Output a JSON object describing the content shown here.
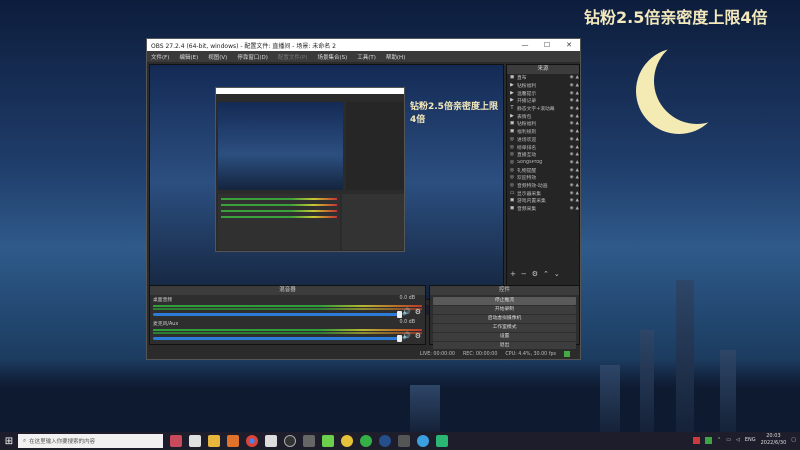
{
  "desktop": {
    "banner": "钻粉2.5倍亲密度上限4倍"
  },
  "window": {
    "title": "OBS 27.2.4 (64-bit, windows) - 配置文件: 直播间 - 场景: 未命名 2",
    "menu": [
      "文件(F)",
      "编辑(E)",
      "视图(V)",
      "停靠窗口(D)",
      "配置文件(P)",
      "场景集合(S)",
      "工具(T)",
      "帮助(H)"
    ]
  },
  "preview": {
    "watermark": "钻粉2.5倍亲密度上限4倍",
    "mini_search": "在这里输入你要搜索的内容"
  },
  "sources": {
    "title": "来源",
    "items": [
      {
        "label": "直布",
        "icon": "image"
      },
      {
        "label": "钻粉福利",
        "icon": "play"
      },
      {
        "label": "温馨提示",
        "icon": "play"
      },
      {
        "label": "开播记录",
        "icon": "play"
      },
      {
        "label": "静态文字+滚动幕",
        "icon": "text"
      },
      {
        "label": "表情包",
        "icon": "play"
      },
      {
        "label": "钻粉福利",
        "icon": "image"
      },
      {
        "label": "福利规则",
        "icon": "image"
      },
      {
        "label": "进场欢迎",
        "icon": "globe"
      },
      {
        "label": "榜单排名",
        "icon": "globe"
      },
      {
        "label": "直播互动",
        "icon": "globe"
      },
      {
        "label": "SongsProg",
        "icon": "globe"
      },
      {
        "label": "礼物提醒",
        "icon": "globe"
      },
      {
        "label": "欢迎特效",
        "icon": "globe"
      },
      {
        "label": "音频特效-动画",
        "icon": "globe"
      },
      {
        "label": "显示器采集",
        "icon": "monitor"
      },
      {
        "label": "游戏内置采集",
        "icon": "image"
      },
      {
        "label": "音频采集",
        "icon": "image"
      }
    ]
  },
  "mixer": {
    "title": "混音器",
    "tracks": [
      {
        "name": "桌面音频",
        "db": "0.0 dB",
        "level": 0.92
      },
      {
        "name": "麦克风/Aux",
        "db": "0.0 dB",
        "level": 0.92
      }
    ]
  },
  "controls": {
    "title": "控件",
    "buttons": [
      "停止推流",
      "开始录制",
      "启动虚拟摄像机",
      "工作室模式",
      "设置",
      "退出"
    ]
  },
  "status": {
    "live": "LIVE: 00:00:00",
    "rec": "REC: 00:00:00",
    "cpu": "CPU: 4.4%, 30.00 fps"
  },
  "taskbar": {
    "search_placeholder": "在这里输入你要搜索的内容",
    "lang": "ENG",
    "time": "20:03",
    "date": "2022/6/30"
  }
}
